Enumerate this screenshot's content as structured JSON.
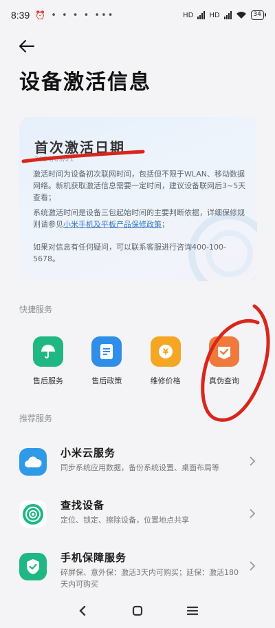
{
  "status_bar": {
    "time": "8:39",
    "dots": "• • • • •••",
    "network_1": "HD",
    "network_2": "HD",
    "battery": "34"
  },
  "page": {
    "title": "设备激活信息"
  },
  "info_card": {
    "title": "首次激活日期",
    "date": "2024/09/21",
    "paragraph1": "激活时间为设备初次联网时间，包括但不限于WLAN、移动数据网络。新机获取激活信息需要一定时间，建议设备联网后3~5天查看；",
    "paragraph2_prefix": "系统激活时间是设备三包起始时间的主要判断依据，详细保修规则请参见",
    "paragraph2_link": "小米手机及平板产品保修政策",
    "paragraph2_suffix": "；",
    "paragraph3": "如果对信息有任何疑问，可以联系客服进行咨询400-100-5678。"
  },
  "quick_services": {
    "label": "快捷服务",
    "items": [
      {
        "label": "售后服务",
        "icon": "umbrella-icon",
        "color": "#1fb883"
      },
      {
        "label": "售后政策",
        "icon": "document-icon",
        "color": "#2f8ee8"
      },
      {
        "label": "维修价格",
        "icon": "yen-coin-icon",
        "color": "#f5a623"
      },
      {
        "label": "真伪查询",
        "icon": "verify-badge-icon",
        "color": "#f07a3c"
      }
    ]
  },
  "recommended_services": {
    "label": "推荐服务",
    "items": [
      {
        "title": "小米云服务",
        "desc": "同步系统应用数据，备份系统设置、桌面布局等",
        "icon": "cloud-icon",
        "color": "#2f9be8"
      },
      {
        "title": "查找设备",
        "desc": "定位、锁定、擦除设备，位置地点共享",
        "icon": "radar-icon",
        "color": "#1fb883"
      },
      {
        "title": "手机保障服务",
        "desc": "碎屏保、意外保：激活3天内可购买；延保：激活180天内可购买",
        "icon": "shield-check-icon",
        "color": "#1fb883"
      }
    ]
  },
  "nav": {
    "back": "back-icon",
    "home": "home-icon",
    "menu": "menu-icon"
  }
}
